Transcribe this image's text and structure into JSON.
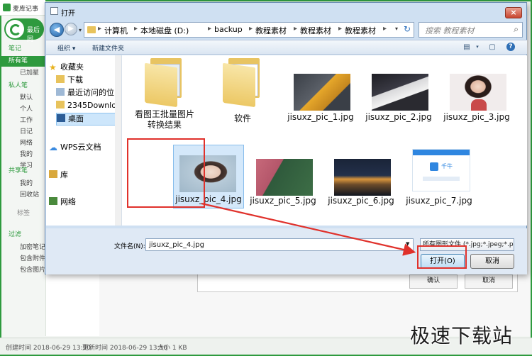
{
  "app": {
    "title": "麦库记事",
    "green_button_label": "最后同",
    "sidebar": [
      {
        "label": "笔记",
        "kind": "section"
      },
      {
        "label": "所有笔",
        "kind": "selected"
      },
      {
        "label": "已加星",
        "kind": "item"
      },
      {
        "label": "私人笔",
        "kind": "section"
      },
      {
        "label": "默认",
        "kind": "item"
      },
      {
        "label": "个人",
        "kind": "item"
      },
      {
        "label": "工作",
        "kind": "item"
      },
      {
        "label": "日记",
        "kind": "item"
      },
      {
        "label": "网络",
        "kind": "item"
      },
      {
        "label": "我的",
        "kind": "item"
      },
      {
        "label": "学习",
        "kind": "item"
      },
      {
        "label": "共享笔",
        "kind": "section"
      },
      {
        "label": "我的",
        "kind": "item"
      },
      {
        "label": "回收站",
        "kind": "item"
      },
      {
        "label": "标签",
        "kind": "gray"
      },
      {
        "label": "过滤",
        "kind": "section"
      },
      {
        "label": "加密笔记",
        "kind": "item"
      },
      {
        "label": "包含附件",
        "kind": "item"
      },
      {
        "label": "包含图片",
        "kind": "item"
      }
    ],
    "editor_buttons": {
      "ok": "确认",
      "cancel": "取消"
    },
    "status": {
      "created": "创建时间 2018-06-29 13:50",
      "updated": "更新时间 2018-06-29 13:50",
      "size": "大小 1 KB"
    },
    "watermark": "极速下载站"
  },
  "dialog": {
    "title": "打开",
    "close_label": "×",
    "breadcrumbs": [
      "计算机",
      "本地磁盘 (D:)",
      "backup",
      "教程素材",
      "教程素材",
      "教程素材"
    ],
    "search_placeholder": "搜索 教程素材",
    "toolbar": {
      "organize": "组织 ▾",
      "new_folder": "新建文件夹"
    },
    "nav_items": [
      {
        "label": "收藏夹",
        "icon": "star-icon"
      },
      {
        "label": "下载",
        "icon": "download-folder-icon"
      },
      {
        "label": "最近访问的位",
        "icon": "recent-icon"
      },
      {
        "label": "2345Downlo",
        "icon": "folder-icon"
      },
      {
        "label": "桌面",
        "icon": "desktop-icon",
        "selected": true
      },
      {
        "label": "WPS云文档",
        "icon": "cloud-icon"
      },
      {
        "label": "库",
        "icon": "library-icon"
      },
      {
        "label": "网络",
        "icon": "network-icon"
      }
    ],
    "files": [
      {
        "name": "看图王批量图片\n转换结果",
        "type": "folder"
      },
      {
        "name": "软件",
        "type": "folder"
      },
      {
        "name": "jisuxz_pic_1.jpg",
        "type": "image",
        "colors": [
          "#3a3f47",
          "#e6a72a"
        ]
      },
      {
        "name": "jisuxz_pic_2.jpg",
        "type": "image",
        "colors": [
          "#1e1e24",
          "#d8d8da"
        ]
      },
      {
        "name": "jisuxz_pic_3.jpg",
        "type": "image",
        "colors": [
          "#f1ecec",
          "#c94a4a"
        ]
      },
      {
        "name": "jisuxz_pic_4.jpg",
        "type": "image",
        "colors": [
          "#9fb7c8",
          "#e8d8cc"
        ],
        "selected": true
      },
      {
        "name": "jisuxz_pic_5.jpg",
        "type": "image",
        "colors": [
          "#c7697a",
          "#2f5a3c"
        ]
      },
      {
        "name": "jisuxz_pic_6.jpg",
        "type": "image",
        "colors": [
          "#1a2438",
          "#d9953c"
        ]
      },
      {
        "name": "jisuxz_pic_7.jpg",
        "type": "image",
        "colors": [
          "#ffffff",
          "#2f86e0"
        ]
      }
    ],
    "thumb_7_label": "千牛",
    "filename_label": "文件名(N):",
    "filename_value": "jisuxz_pic_4.jpg",
    "filetype_value": "所有图形文件 (*.jpg;*.jpeg;*.p",
    "open_button": "打开(O)",
    "cancel_button": "取消"
  }
}
